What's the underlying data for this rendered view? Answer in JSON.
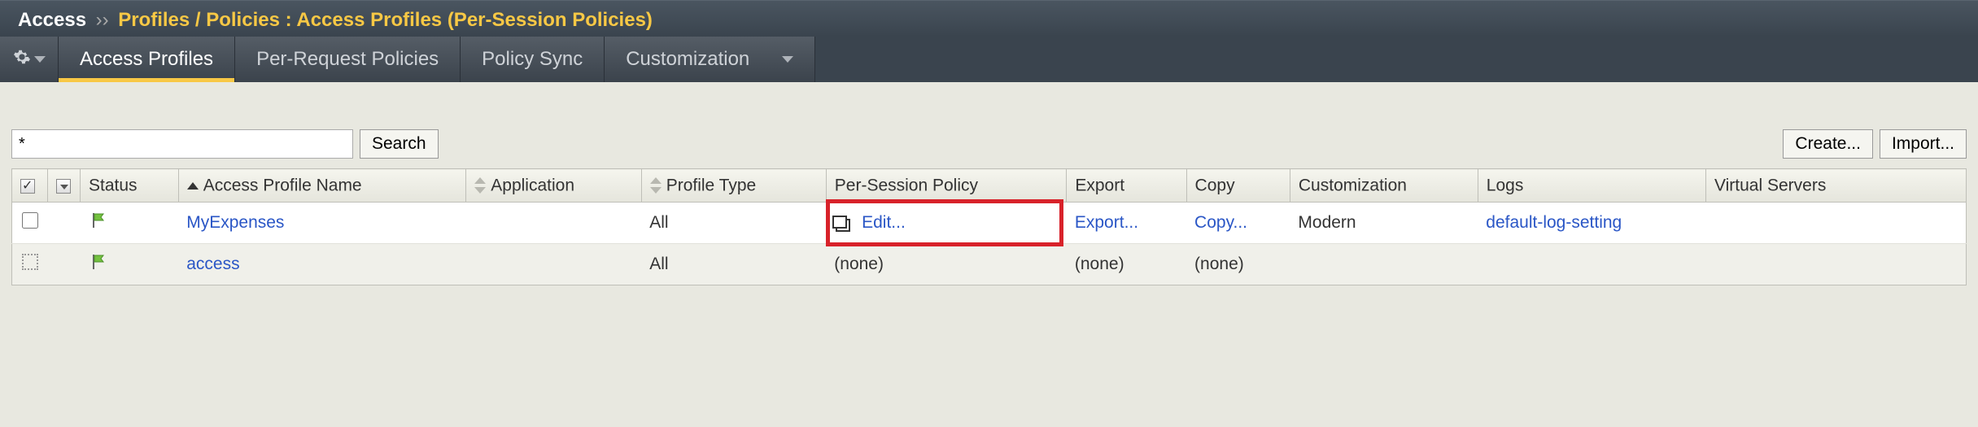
{
  "breadcrumb": {
    "root": "Access",
    "separator": "››",
    "path": "Profiles / Policies : Access Profiles (Per-Session Policies)"
  },
  "tabs": {
    "items": [
      {
        "label": "Access Profiles",
        "active": true
      },
      {
        "label": "Per-Request Policies",
        "active": false
      },
      {
        "label": "Policy Sync",
        "active": false
      },
      {
        "label": "Customization",
        "active": false,
        "dropdown": true
      }
    ]
  },
  "toolbar": {
    "search_value": "*",
    "search_button": "Search",
    "create_button": "Create...",
    "import_button": "Import..."
  },
  "table": {
    "columns": {
      "status": "Status",
      "name": "Access Profile Name",
      "application": "Application",
      "profile_type": "Profile Type",
      "per_session": "Per-Session Policy",
      "export": "Export",
      "copy": "Copy",
      "customization": "Customization",
      "logs": "Logs",
      "virtual_servers": "Virtual Servers"
    },
    "rows": [
      {
        "checkbox": "enabled",
        "status_color": "#74c23f",
        "name": "MyExpenses",
        "application": "",
        "profile_type": "All",
        "per_session": "Edit...",
        "per_session_highlight": true,
        "export": "Export...",
        "copy": "Copy...",
        "customization": "Modern",
        "logs": "default-log-setting",
        "virtual_servers": ""
      },
      {
        "checkbox": "dotted",
        "status_color": "#74c23f",
        "name": "access",
        "application": "",
        "profile_type": "All",
        "per_session": "(none)",
        "per_session_highlight": false,
        "export": "(none)",
        "copy": "(none)",
        "customization": "",
        "logs": "",
        "virtual_servers": ""
      }
    ]
  }
}
